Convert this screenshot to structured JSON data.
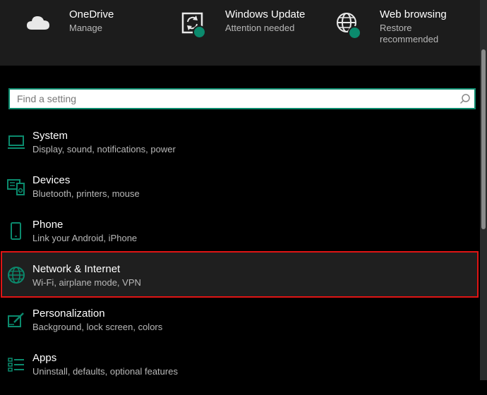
{
  "quick_links": [
    {
      "title": "OneDrive",
      "subtitle": "Manage",
      "icon": "cloud-icon"
    },
    {
      "title": "Windows Update",
      "subtitle": "Attention needed",
      "icon": "sync-icon"
    },
    {
      "title": "Web browsing",
      "subtitle": "Restore recommended",
      "icon": "globe-icon"
    }
  ],
  "search": {
    "placeholder": "Find a setting"
  },
  "settings": [
    {
      "title": "System",
      "description": "Display, sound, notifications, power",
      "icon": "laptop-icon"
    },
    {
      "title": "Devices",
      "description": "Bluetooth, printers, mouse",
      "icon": "devices-icon"
    },
    {
      "title": "Phone",
      "description": "Link your Android, iPhone",
      "icon": "phone-icon"
    },
    {
      "title": "Network & Internet",
      "description": "Wi-Fi, airplane mode, VPN",
      "icon": "globe-icon"
    },
    {
      "title": "Personalization",
      "description": "Background, lock screen, colors",
      "icon": "paintbrush-icon"
    },
    {
      "title": "Apps",
      "description": "Uninstall, defaults, optional features",
      "icon": "apps-list-icon"
    }
  ],
  "colors": {
    "accent": "#0b8a6d",
    "highlight": "#e01414",
    "top_bar": "#1c1c1c"
  }
}
